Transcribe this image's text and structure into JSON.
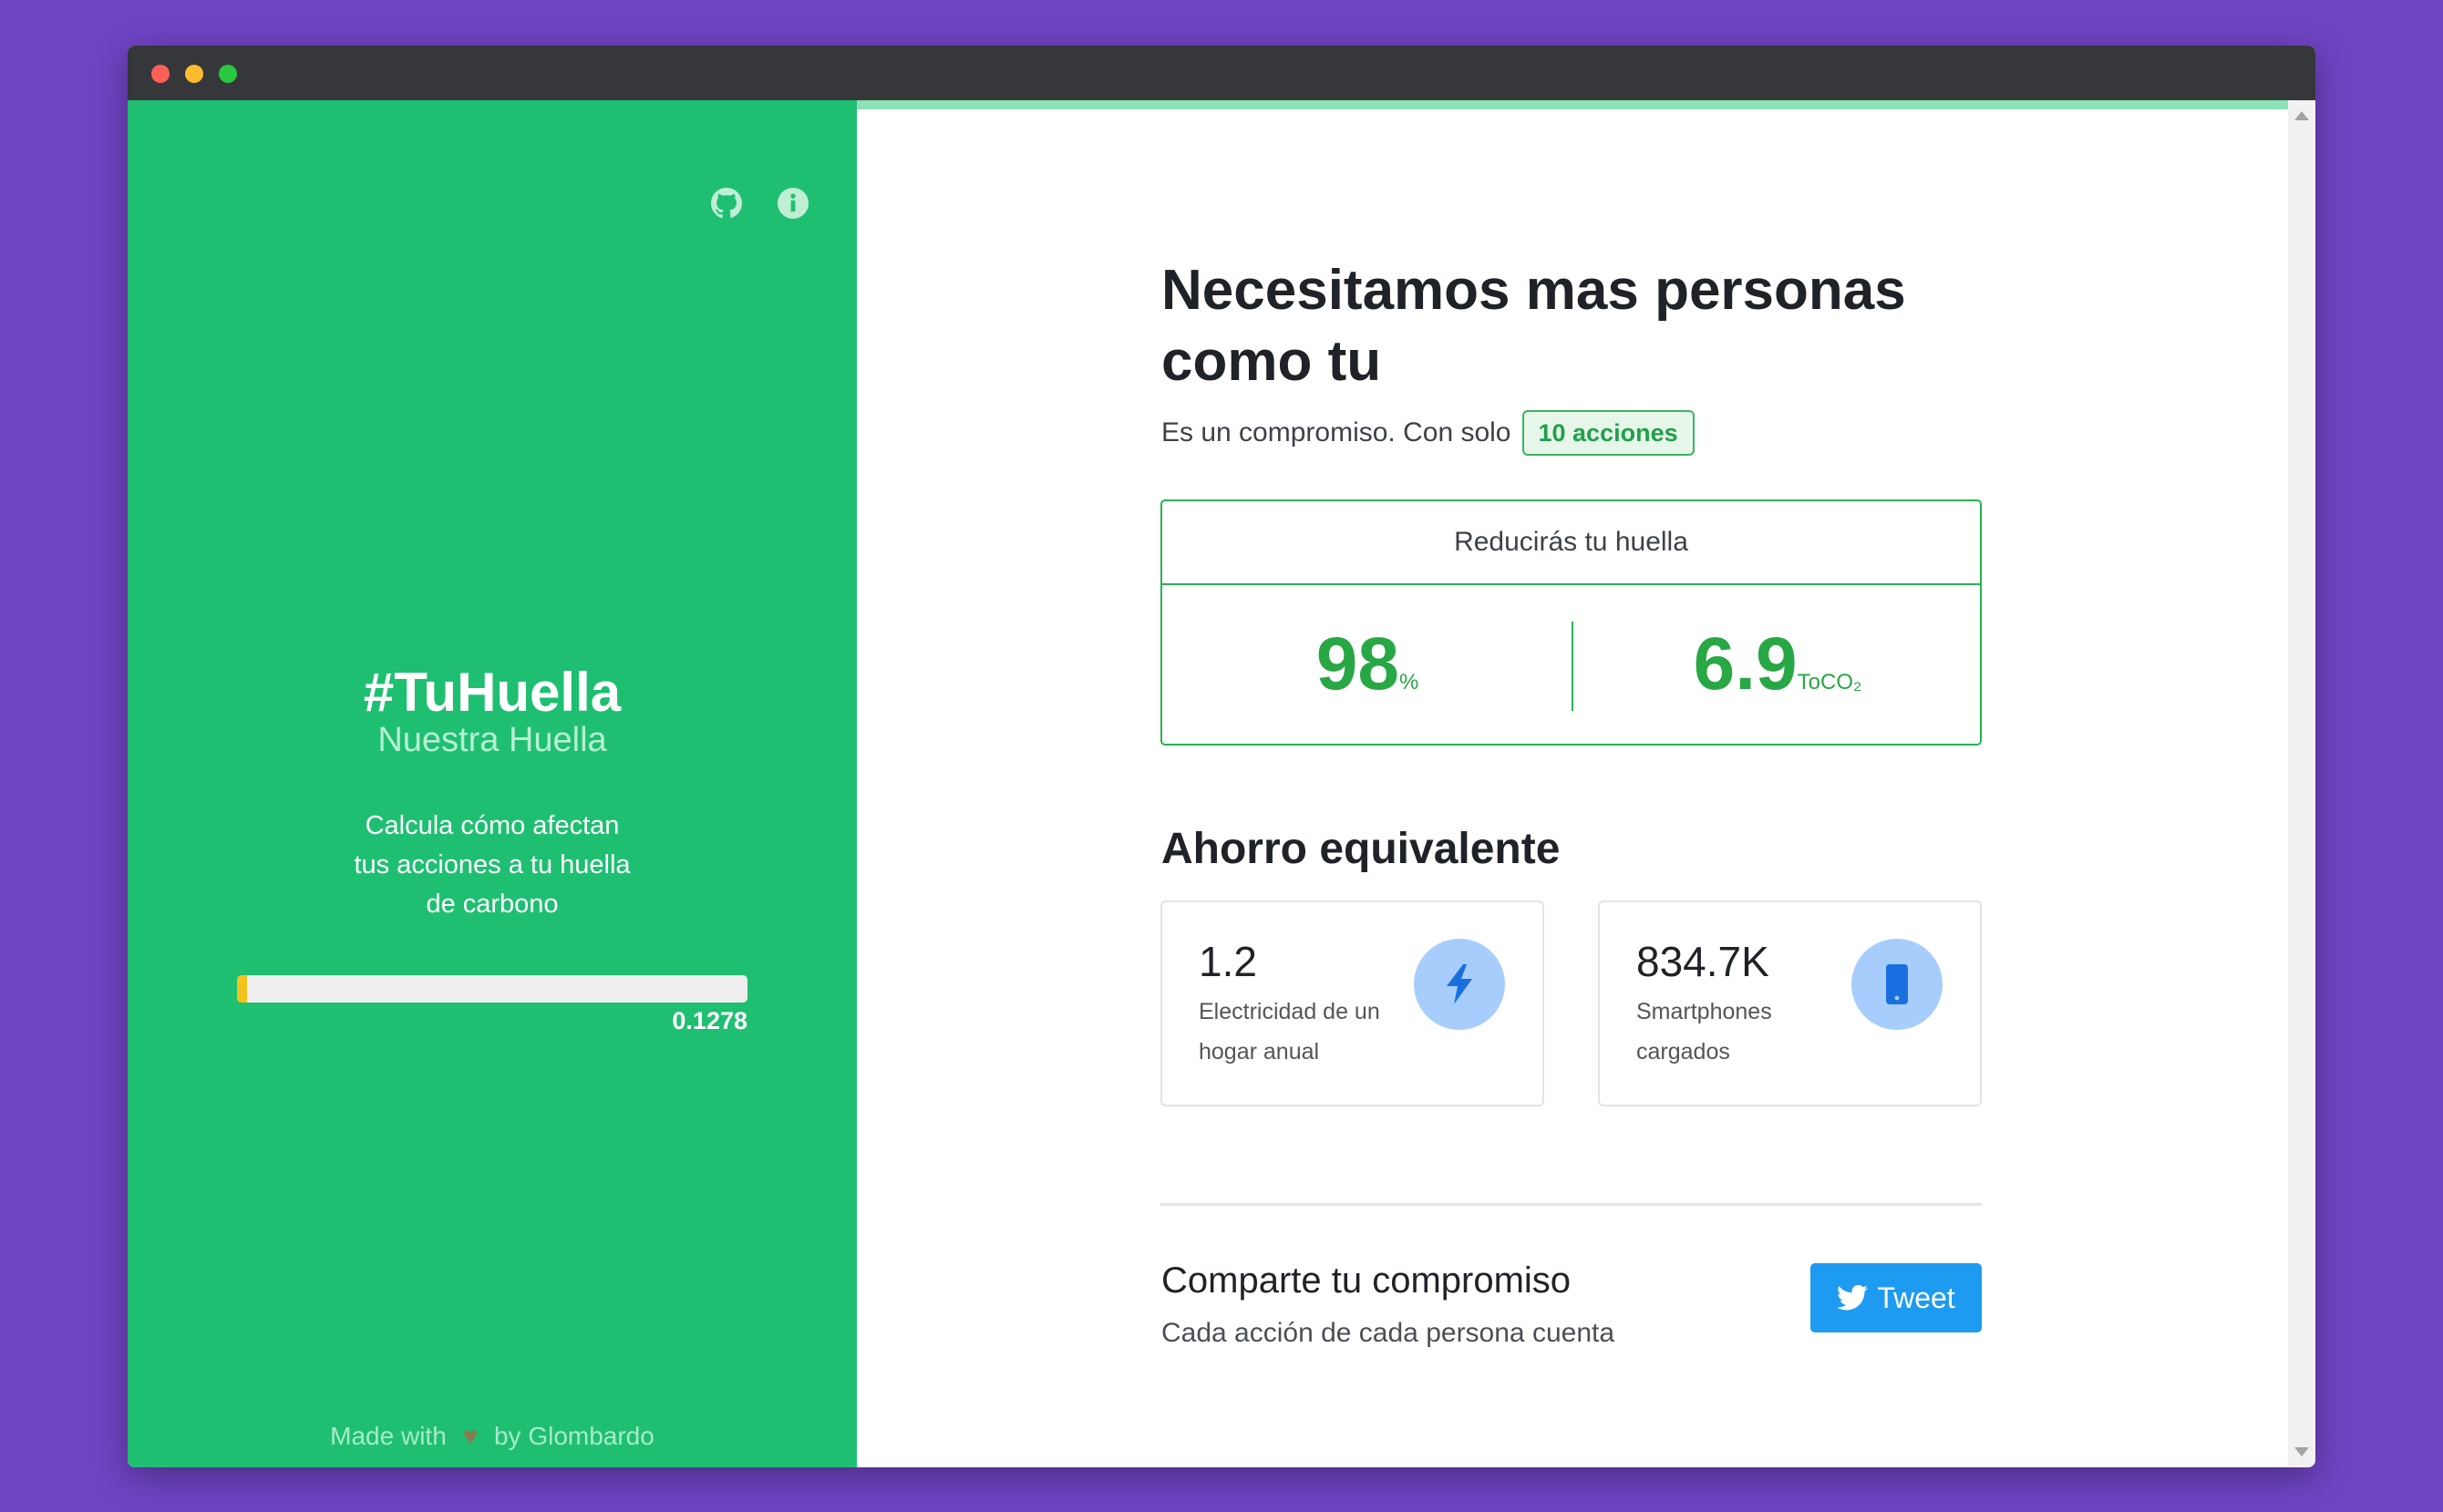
{
  "window": {
    "controls": [
      "close",
      "minimize",
      "maximize"
    ]
  },
  "sidebar": {
    "icons": [
      "github-icon",
      "info-icon"
    ],
    "title": "#TuHuella",
    "subtitle": "Nuestra Huella",
    "description": "Calcula cómo afectan tus acciones a tu huella de carbono",
    "progress": {
      "value": 0.1278,
      "label": "0.1278"
    },
    "footer": {
      "made_with": "Made with",
      "by": "by Glombardo",
      "heart_icon": "heart-icon"
    }
  },
  "main": {
    "title": "Necesitamos mas personas como tu",
    "commitment_text": "Es un compromiso. Con solo",
    "actions_badge": "10 acciones",
    "reduction": {
      "header": "Reducirás tu huella",
      "percent_value": "98",
      "percent_unit": "%",
      "co2_value": "6.9",
      "co2_unit": "ToCO₂"
    },
    "savings_title": "Ahorro equivalente",
    "savings": [
      {
        "value": "1.2",
        "label": "Electricidad de un hogar anual",
        "icon": "lightning-icon"
      },
      {
        "value": "834.7K",
        "label": "Smartphones cargados",
        "icon": "smartphone-icon"
      }
    ],
    "share": {
      "title": "Comparte tu compromiso",
      "subtitle": "Cada acción de cada persona cuenta",
      "tweet_label": "Tweet"
    }
  },
  "colors": {
    "sidebar_bg": "#1fbf72",
    "accent_green": "#28a745",
    "tweet_blue": "#1d9bf0",
    "icon_circle": "#a7cdfc",
    "page_bg": "#7044c4"
  }
}
